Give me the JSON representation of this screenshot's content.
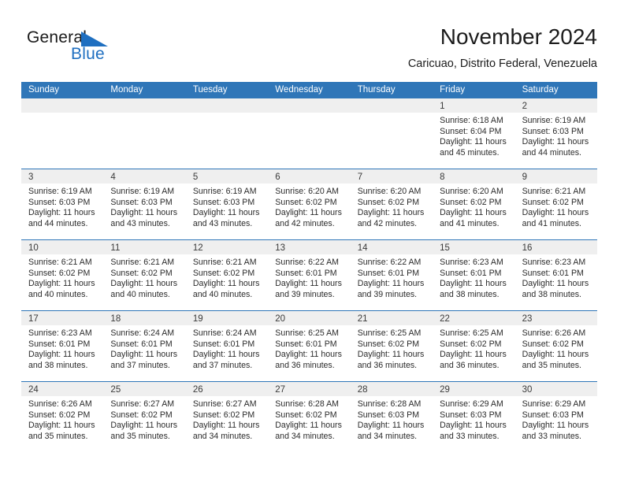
{
  "logo": {
    "text_top": "General",
    "text_bottom": "Blue",
    "triangle_name": "blue-triangle-icon",
    "color_top": "#1a1a1a",
    "color_bottom": "#1f6fc0"
  },
  "header": {
    "title": "November 2024",
    "subtitle": "Caricuao, Distrito Federal, Venezuela"
  },
  "theme": {
    "header_blue": "#2f76b8",
    "day_band_gray": "#efefef",
    "text_dark": "#2b2b2b"
  },
  "weekdays": [
    "Sunday",
    "Monday",
    "Tuesday",
    "Wednesday",
    "Thursday",
    "Friday",
    "Saturday"
  ],
  "weeks": [
    [
      {
        "day": "",
        "lines": []
      },
      {
        "day": "",
        "lines": []
      },
      {
        "day": "",
        "lines": []
      },
      {
        "day": "",
        "lines": []
      },
      {
        "day": "",
        "lines": []
      },
      {
        "day": "1",
        "lines": [
          "Sunrise: 6:18 AM",
          "Sunset: 6:04 PM",
          "Daylight: 11 hours",
          "and 45 minutes."
        ]
      },
      {
        "day": "2",
        "lines": [
          "Sunrise: 6:19 AM",
          "Sunset: 6:03 PM",
          "Daylight: 11 hours",
          "and 44 minutes."
        ]
      }
    ],
    [
      {
        "day": "3",
        "lines": [
          "Sunrise: 6:19 AM",
          "Sunset: 6:03 PM",
          "Daylight: 11 hours",
          "and 44 minutes."
        ]
      },
      {
        "day": "4",
        "lines": [
          "Sunrise: 6:19 AM",
          "Sunset: 6:03 PM",
          "Daylight: 11 hours",
          "and 43 minutes."
        ]
      },
      {
        "day": "5",
        "lines": [
          "Sunrise: 6:19 AM",
          "Sunset: 6:03 PM",
          "Daylight: 11 hours",
          "and 43 minutes."
        ]
      },
      {
        "day": "6",
        "lines": [
          "Sunrise: 6:20 AM",
          "Sunset: 6:02 PM",
          "Daylight: 11 hours",
          "and 42 minutes."
        ]
      },
      {
        "day": "7",
        "lines": [
          "Sunrise: 6:20 AM",
          "Sunset: 6:02 PM",
          "Daylight: 11 hours",
          "and 42 minutes."
        ]
      },
      {
        "day": "8",
        "lines": [
          "Sunrise: 6:20 AM",
          "Sunset: 6:02 PM",
          "Daylight: 11 hours",
          "and 41 minutes."
        ]
      },
      {
        "day": "9",
        "lines": [
          "Sunrise: 6:21 AM",
          "Sunset: 6:02 PM",
          "Daylight: 11 hours",
          "and 41 minutes."
        ]
      }
    ],
    [
      {
        "day": "10",
        "lines": [
          "Sunrise: 6:21 AM",
          "Sunset: 6:02 PM",
          "Daylight: 11 hours",
          "and 40 minutes."
        ]
      },
      {
        "day": "11",
        "lines": [
          "Sunrise: 6:21 AM",
          "Sunset: 6:02 PM",
          "Daylight: 11 hours",
          "and 40 minutes."
        ]
      },
      {
        "day": "12",
        "lines": [
          "Sunrise: 6:21 AM",
          "Sunset: 6:02 PM",
          "Daylight: 11 hours",
          "and 40 minutes."
        ]
      },
      {
        "day": "13",
        "lines": [
          "Sunrise: 6:22 AM",
          "Sunset: 6:01 PM",
          "Daylight: 11 hours",
          "and 39 minutes."
        ]
      },
      {
        "day": "14",
        "lines": [
          "Sunrise: 6:22 AM",
          "Sunset: 6:01 PM",
          "Daylight: 11 hours",
          "and 39 minutes."
        ]
      },
      {
        "day": "15",
        "lines": [
          "Sunrise: 6:23 AM",
          "Sunset: 6:01 PM",
          "Daylight: 11 hours",
          "and 38 minutes."
        ]
      },
      {
        "day": "16",
        "lines": [
          "Sunrise: 6:23 AM",
          "Sunset: 6:01 PM",
          "Daylight: 11 hours",
          "and 38 minutes."
        ]
      }
    ],
    [
      {
        "day": "17",
        "lines": [
          "Sunrise: 6:23 AM",
          "Sunset: 6:01 PM",
          "Daylight: 11 hours",
          "and 38 minutes."
        ]
      },
      {
        "day": "18",
        "lines": [
          "Sunrise: 6:24 AM",
          "Sunset: 6:01 PM",
          "Daylight: 11 hours",
          "and 37 minutes."
        ]
      },
      {
        "day": "19",
        "lines": [
          "Sunrise: 6:24 AM",
          "Sunset: 6:01 PM",
          "Daylight: 11 hours",
          "and 37 minutes."
        ]
      },
      {
        "day": "20",
        "lines": [
          "Sunrise: 6:25 AM",
          "Sunset: 6:01 PM",
          "Daylight: 11 hours",
          "and 36 minutes."
        ]
      },
      {
        "day": "21",
        "lines": [
          "Sunrise: 6:25 AM",
          "Sunset: 6:02 PM",
          "Daylight: 11 hours",
          "and 36 minutes."
        ]
      },
      {
        "day": "22",
        "lines": [
          "Sunrise: 6:25 AM",
          "Sunset: 6:02 PM",
          "Daylight: 11 hours",
          "and 36 minutes."
        ]
      },
      {
        "day": "23",
        "lines": [
          "Sunrise: 6:26 AM",
          "Sunset: 6:02 PM",
          "Daylight: 11 hours",
          "and 35 minutes."
        ]
      }
    ],
    [
      {
        "day": "24",
        "lines": [
          "Sunrise: 6:26 AM",
          "Sunset: 6:02 PM",
          "Daylight: 11 hours",
          "and 35 minutes."
        ]
      },
      {
        "day": "25",
        "lines": [
          "Sunrise: 6:27 AM",
          "Sunset: 6:02 PM",
          "Daylight: 11 hours",
          "and 35 minutes."
        ]
      },
      {
        "day": "26",
        "lines": [
          "Sunrise: 6:27 AM",
          "Sunset: 6:02 PM",
          "Daylight: 11 hours",
          "and 34 minutes."
        ]
      },
      {
        "day": "27",
        "lines": [
          "Sunrise: 6:28 AM",
          "Sunset: 6:02 PM",
          "Daylight: 11 hours",
          "and 34 minutes."
        ]
      },
      {
        "day": "28",
        "lines": [
          "Sunrise: 6:28 AM",
          "Sunset: 6:03 PM",
          "Daylight: 11 hours",
          "and 34 minutes."
        ]
      },
      {
        "day": "29",
        "lines": [
          "Sunrise: 6:29 AM",
          "Sunset: 6:03 PM",
          "Daylight: 11 hours",
          "and 33 minutes."
        ]
      },
      {
        "day": "30",
        "lines": [
          "Sunrise: 6:29 AM",
          "Sunset: 6:03 PM",
          "Daylight: 11 hours",
          "and 33 minutes."
        ]
      }
    ]
  ]
}
